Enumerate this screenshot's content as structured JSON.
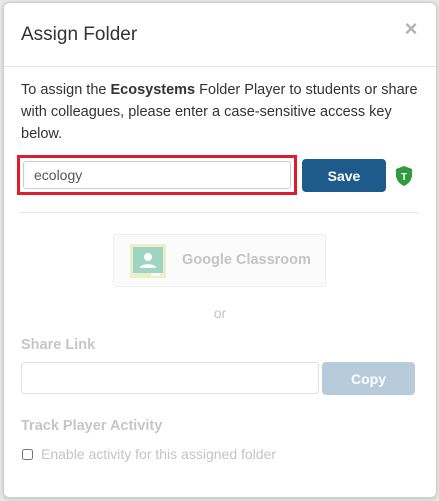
{
  "modal": {
    "title": "Assign Folder",
    "close_glyph": "×"
  },
  "intro": {
    "prefix": "To assign the ",
    "folder_name": "Ecosystems",
    "suffix": " Folder Player to students or share with colleagues, please enter a case-sensitive access key below."
  },
  "access_key": {
    "value": "ecology"
  },
  "buttons": {
    "save": "Save",
    "copy": "Copy"
  },
  "shield_icon": {
    "letter": "T",
    "color": "#2e9b3f"
  },
  "google_classroom": {
    "label": "Google Classroom"
  },
  "separator": "or",
  "share_link": {
    "label": "Share Link",
    "value": ""
  },
  "track": {
    "label": "Track Player Activity",
    "checkbox_label": "Enable activity for this assigned folder"
  },
  "colors": {
    "save_button": "#1f5a8c",
    "copy_button_disabled": "#b7cbdb",
    "highlight": "#e01b2b"
  }
}
